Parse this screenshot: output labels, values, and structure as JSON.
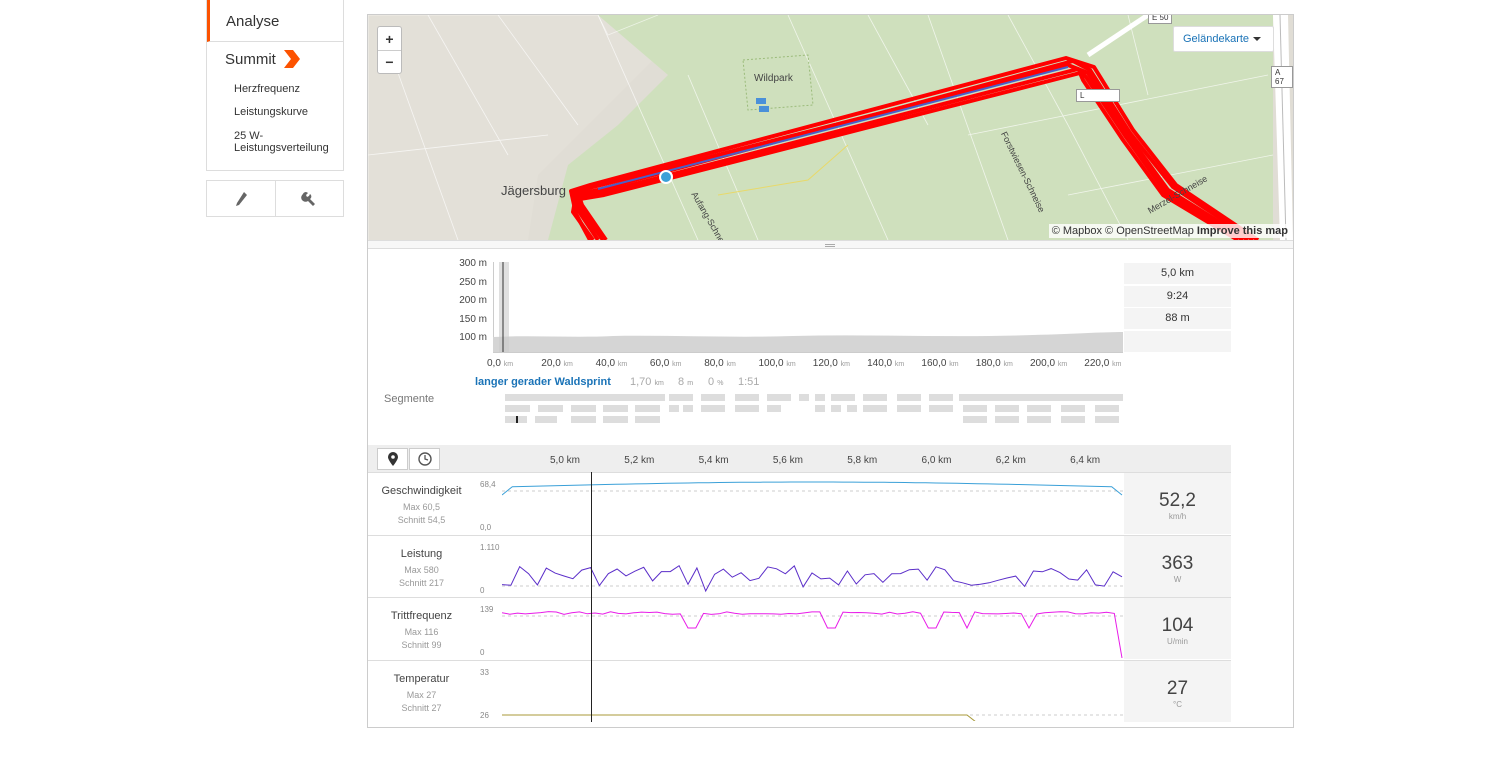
{
  "sidebar": {
    "analyse": "Analyse",
    "summit": "Summit",
    "sub_items": [
      "Herzfrequenz",
      "Leistungskurve",
      "25 W-Leistungsverteilung"
    ],
    "tools": [
      "pencil-icon",
      "wrench-icon"
    ],
    "accent": "#fc5200"
  },
  "map": {
    "zoom_in": "+",
    "zoom_out": "−",
    "layer_button": "Geländekarte",
    "attribution": "© Mapbox © OpenStreetMap",
    "attribution_link": "Improve this map",
    "place_labels": {
      "town": "Jägersburg",
      "park": "Wildpark",
      "road1": "Forstwiesen-Schneise",
      "road2": "Merzel-Schneise",
      "road3": "Aufang-Schneise"
    },
    "shields": [
      "E 50",
      "A 67",
      "L"
    ],
    "route_color": "#ff0000"
  },
  "elevation": {
    "y_ticks": [
      "300 m",
      "250 m",
      "200 m",
      "150 m",
      "100 m"
    ],
    "x_ticks": [
      {
        "v": "0,0",
        "u": "km"
      },
      {
        "v": "20,0",
        "u": "km"
      },
      {
        "v": "40,0",
        "u": "km"
      },
      {
        "v": "60,0",
        "u": "km"
      },
      {
        "v": "80,0",
        "u": "km"
      },
      {
        "v": "100,0",
        "u": "km"
      },
      {
        "v": "120,0",
        "u": "km"
      },
      {
        "v": "140,0",
        "u": "km"
      },
      {
        "v": "160,0",
        "u": "km"
      },
      {
        "v": "180,0",
        "u": "km"
      },
      {
        "v": "200,0",
        "u": "km"
      },
      {
        "v": "220,0",
        "u": "km"
      }
    ],
    "stats": [
      "5,0 km",
      "9:24",
      "88 m",
      ""
    ]
  },
  "segment": {
    "title": "langer gerader Waldsprint",
    "distance": "1,70",
    "distance_unit": "km",
    "elev": "8",
    "elev_unit": "m",
    "grade": "0",
    "grade_unit": "%",
    "time": "1:51",
    "label": "Segmente"
  },
  "streams": {
    "x_ticks": [
      "5,0 km",
      "5,2 km",
      "5,4 km",
      "5,6 km",
      "5,8 km",
      "6,0 km",
      "6,2 km",
      "6,4 km"
    ],
    "rows": [
      {
        "name": "Geschwindigkeit",
        "max": "Max 60,5",
        "avg": "Schnitt 54,5",
        "top": "68,4",
        "bottom": "0,0",
        "value": "52,2",
        "unit": "km/h",
        "color": "#3aa0d8"
      },
      {
        "name": "Leistung",
        "max": "Max 580",
        "avg": "Schnitt 217",
        "top": "1.110",
        "bottom": "0",
        "value": "363",
        "unit": "W",
        "color": "#5b2ec9"
      },
      {
        "name": "Trittfrequenz",
        "max": "Max 116",
        "avg": "Schnitt 99",
        "top": "139",
        "bottom": "0",
        "value": "104",
        "unit": "U/min",
        "color": "#e81ce8"
      },
      {
        "name": "Temperatur",
        "max": "Max 27",
        "avg": "Schnitt 27",
        "top": "33",
        "bottom": "26",
        "value": "27",
        "unit": "°C",
        "color": "#a89a3a"
      }
    ]
  }
}
